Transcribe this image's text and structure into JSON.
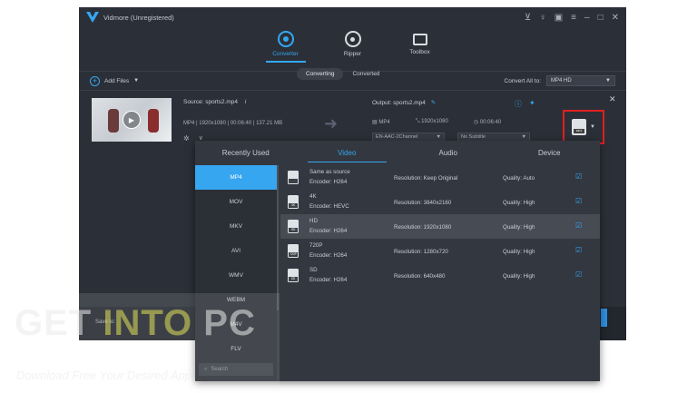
{
  "window": {
    "title": "Vidmore (Unregistered)"
  },
  "nav": [
    {
      "label": "Converter",
      "active": true
    },
    {
      "label": "Ripper",
      "active": false
    },
    {
      "label": "Toolbox",
      "active": false
    }
  ],
  "toolbar": {
    "add_files": "Add Files",
    "tab_converting": "Converting",
    "tab_converted": "Converted",
    "convert_all_label": "Convert All to:",
    "convert_all_value": "MP4 HD"
  },
  "file": {
    "source": "Source: sports2.mp4",
    "meta": "MP4 | 1920x1080 | 00:06:40 | 137.21 MB",
    "output": "Output: sports2.mp4",
    "out_format": "MP4",
    "out_resolution": "1920x1080",
    "out_duration": "00:06:40",
    "audio_track": "EN-AAC-2Channel",
    "subtitle": "No Subtitle"
  },
  "format_panel": {
    "tabs": [
      "Recently Used",
      "Video",
      "Audio",
      "Device"
    ],
    "active_tab": "Video",
    "formats": [
      "MP4",
      "MOV",
      "MKV",
      "AVI",
      "WMV",
      "WEBM",
      "M4V",
      "FLV"
    ],
    "selected_format": "MP4",
    "search_placeholder": "Search",
    "presets": [
      {
        "icon": "",
        "name": "Same as source",
        "encoder": "Encoder: H264",
        "resolution": "Resolution: Keep Original",
        "quality": "Quality: Auto"
      },
      {
        "icon": "4K",
        "name": "4K",
        "encoder": "Encoder: HEVC",
        "resolution": "Resolution: 3840x2160",
        "quality": "Quality: High"
      },
      {
        "icon": "HD",
        "name": "HD",
        "encoder": "Encoder: H264",
        "resolution": "Resolution: 1920x1080",
        "quality": "Quality: High"
      },
      {
        "icon": "720P",
        "name": "720P",
        "encoder": "Encoder: H264",
        "resolution": "Resolution: 1280x720",
        "quality": "Quality: High"
      },
      {
        "icon": "SD",
        "name": "SD",
        "encoder": "Encoder: H264",
        "resolution": "Resolution: 640x480",
        "quality": "Quality: High"
      }
    ]
  },
  "footer": {
    "save_to": "Save to:"
  },
  "watermark": {
    "title_a": "GET ",
    "title_b": "INTO",
    "title_c": " PC",
    "subtitle": "Download Free Your Desired App"
  }
}
